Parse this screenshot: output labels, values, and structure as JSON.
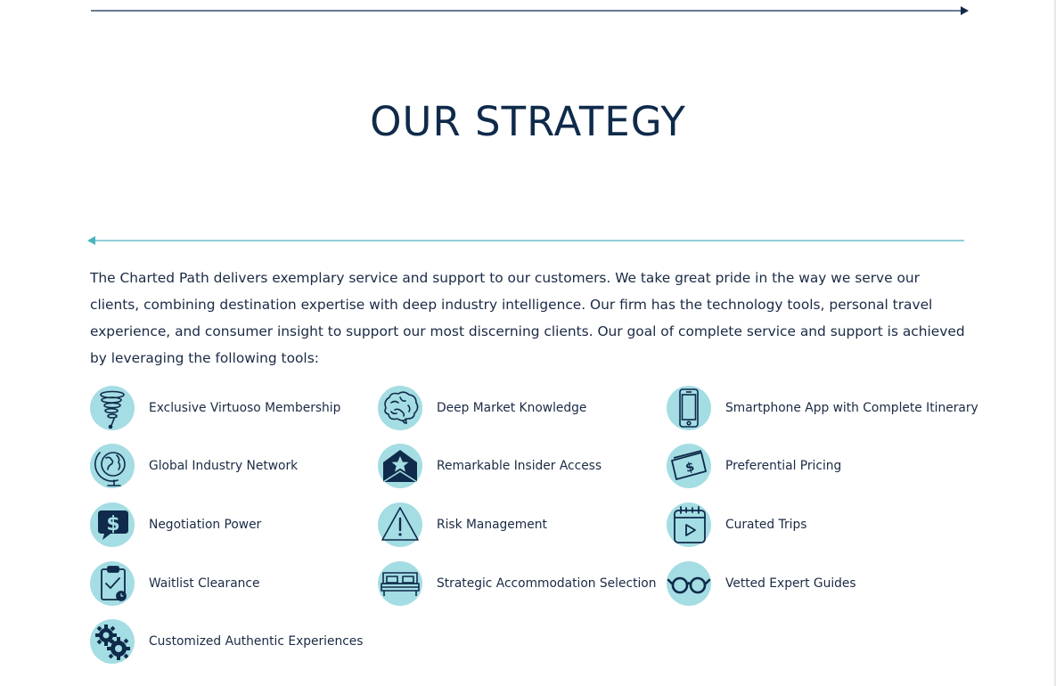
{
  "header": {
    "title": "OUR STRATEGY"
  },
  "intro": {
    "text": "The Charted Path delivers exemplary service and support to our customers. We take great pride in the way we serve our clients, combining destination expertise with deep industry intelligence. Our firm has the technology tools, personal travel experience, and consumer insight to support our most discerning clients. Our goal of complete service and support is achieved by leveraging the following tools:"
  },
  "colors": {
    "navy": "#0f2a4a",
    "teal": "#4bb3bd",
    "icon_bg": "#a4dde3"
  },
  "tools": [
    {
      "label": "Exclusive Virtuoso Membership",
      "icon": "tornado-icon"
    },
    {
      "label": "Deep Market Knowledge",
      "icon": "brain-icon"
    },
    {
      "label": "Smartphone App with Complete Itinerary",
      "icon": "smartphone-icon"
    },
    {
      "label": "Global Industry Network",
      "icon": "globe-icon"
    },
    {
      "label": "Remarkable Insider Access",
      "icon": "star-envelope-icon"
    },
    {
      "label": "Preferential Pricing",
      "icon": "money-icon"
    },
    {
      "label": "Negotiation Power",
      "icon": "dollar-speech-bubble-icon"
    },
    {
      "label": "Risk Management",
      "icon": "warning-icon"
    },
    {
      "label": "Curated Trips",
      "icon": "calendar-play-icon"
    },
    {
      "label": "Waitlist Clearance",
      "icon": "clipboard-check-icon"
    },
    {
      "label": "Strategic Accommodation Selection",
      "icon": "bed-icon"
    },
    {
      "label": "Vetted Expert Guides",
      "icon": "glasses-icon"
    },
    {
      "label": "Customized Authentic Experiences",
      "icon": "gears-icon"
    }
  ]
}
